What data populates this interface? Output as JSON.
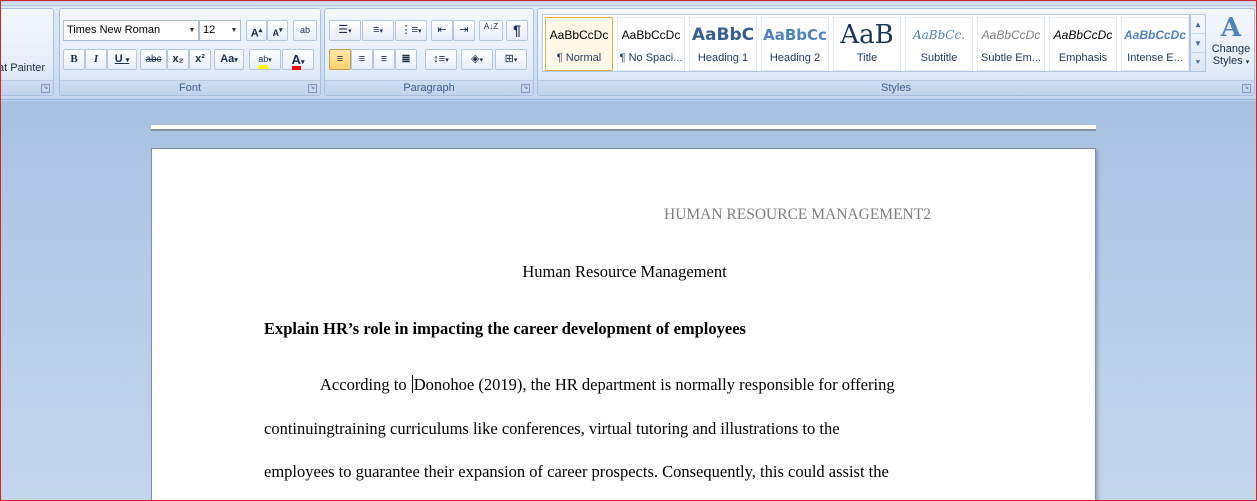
{
  "clipboard": {
    "format_painter_label": "at Painter"
  },
  "font_group": {
    "label": "Font",
    "font_name": "Times New Roman",
    "font_size": "12",
    "grow_font": "A",
    "shrink_font": "A",
    "clear_format": "ab",
    "bold": "B",
    "italic": "I",
    "underline": "U",
    "strikethrough": "abc",
    "subscript": "x₂",
    "superscript": "x²",
    "change_case": "Aa",
    "highlight": "ab",
    "font_color": "A"
  },
  "paragraph_group": {
    "label": "Paragraph",
    "sort": "A↓Z",
    "show_marks": "¶"
  },
  "styles_group": {
    "label": "Styles",
    "items": [
      {
        "preview": "AaBbCcDc",
        "name": "¶ Normal"
      },
      {
        "preview": "AaBbCcDc",
        "name": "¶ No Spaci..."
      },
      {
        "preview": "AaBbC",
        "name": "Heading 1"
      },
      {
        "preview": "AaBbCc",
        "name": "Heading 2"
      },
      {
        "preview": "AaB",
        "name": "Title"
      },
      {
        "preview": "AaBbCc.",
        "name": "Subtitle"
      },
      {
        "preview": "AaBbCcDc",
        "name": "Subtle Em..."
      },
      {
        "preview": "AaBbCcDc",
        "name": "Emphasis"
      },
      {
        "preview": "AaBbCcDc",
        "name": "Intense E..."
      }
    ],
    "change_styles_line1": "Change",
    "change_styles_line2": "Styles"
  },
  "colors": {
    "highlight": "#ffff00",
    "font_color": "#ff0000",
    "accent_frame": "#d1232a"
  },
  "document": {
    "header": "HUMAN RESOURCE MANAGEMENT2",
    "title": "Human Resource Management",
    "heading": "Explain HR’s role in impacting the career development of employees",
    "para_line1_before_caret": "According to ",
    "para_line1_after_caret": "Donohoe (2019), the HR department is normally responsible for offering",
    "para_line2": "continuingtraining curriculums like conferences, virtual tutoring and illustrations to the",
    "para_line3": "employees to guarantee their expansion of career prospects. Consequently, this could assist the"
  }
}
